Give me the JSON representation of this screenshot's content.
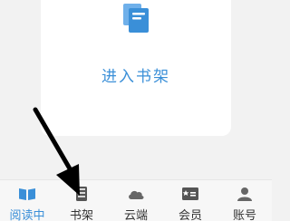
{
  "card": {
    "label": "进入书架",
    "icon": "bookshelf-books-icon"
  },
  "tabbar": {
    "tabs": [
      {
        "label": "阅读中",
        "icon": "open-book-icon",
        "active": true
      },
      {
        "label": "书架",
        "icon": "bookshelf-icon",
        "active": false
      },
      {
        "label": "云端",
        "icon": "cloud-icon",
        "active": false
      },
      {
        "label": "会员",
        "icon": "vip-card-icon",
        "active": false
      },
      {
        "label": "账号",
        "icon": "account-icon",
        "active": false
      }
    ]
  },
  "colors": {
    "accent": "#3a8fd8",
    "background": "#f2f2f2",
    "card": "#ffffff",
    "arrow": "#000000"
  }
}
